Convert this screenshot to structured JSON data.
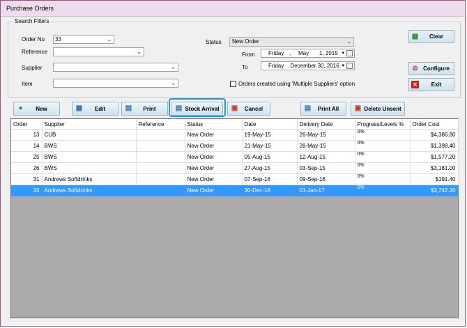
{
  "window": {
    "title": "Purchase Orders"
  },
  "filters": {
    "group_title": "Search Filters",
    "order_no_label": "Order No",
    "order_no_value": "33",
    "reference_label": "Reference",
    "reference_value": "",
    "supplier_label": "Supplier",
    "supplier_value": "",
    "item_label": "Item",
    "item_value": "",
    "status_label": "Status",
    "status_value": "New Order",
    "from_label": "From",
    "from_day": "Friday",
    "from_sep": ",",
    "from_month": "May",
    "from_date": "1, 2015",
    "to_label": "To",
    "to_day": "Friday",
    "to_rest": ", December 30, 2016",
    "multi_supplier_label": "Orders created using 'Multiple Suppliers' option",
    "multi_supplier_checked": false
  },
  "side_buttons": {
    "clear": "Clear",
    "configure": "Configure",
    "exit": "Exit"
  },
  "toolbar": {
    "new": "New",
    "edit": "Edit",
    "print": "Print",
    "stock_arrival": "Stock Arrival",
    "cancel": "Cancel",
    "print_all": "Print All",
    "delete_unsent": "Delete Unsent"
  },
  "table": {
    "columns": [
      "Order",
      "Supplier",
      "Reference",
      "Status",
      "Date",
      "Delivery Date",
      "Progress/Levels %",
      "Order Cost"
    ],
    "rows": [
      {
        "order": "13",
        "supplier": "CUB",
        "reference": "",
        "status": "New Order",
        "date": "19-May-15",
        "delivery": "26-May-15",
        "progress": "0%",
        "cost": "$4,386.80"
      },
      {
        "order": "14",
        "supplier": "BWS",
        "reference": "",
        "status": "New Order",
        "date": "21-May-15",
        "delivery": "28-May-15",
        "progress": "0%",
        "cost": "$1,398.40"
      },
      {
        "order": "25",
        "supplier": "BWS",
        "reference": "",
        "status": "New Order",
        "date": "05-Aug-15",
        "delivery": "12-Aug-15",
        "progress": "0%",
        "cost": "$1,577.20"
      },
      {
        "order": "26",
        "supplier": "BWS",
        "reference": "",
        "status": "New Order",
        "date": "27-Aug-15",
        "delivery": "03-Sep-15",
        "progress": "0%",
        "cost": "$3,181.00"
      },
      {
        "order": "31",
        "supplier": "Andrews Softdrinks",
        "reference": "",
        "status": "New Order",
        "date": "07-Sep-16",
        "delivery": "09-Sep-16",
        "progress": "0%",
        "cost": "$191.40"
      },
      {
        "order": "33",
        "supplier": "Andrews Softdrinks",
        "reference": "",
        "status": "New Order",
        "date": "30-Dec-16",
        "delivery": "01-Jan-17",
        "progress": "0%",
        "cost": "$3,742.20",
        "selected": true
      }
    ]
  },
  "colors": {
    "selection": "#3399ff",
    "grid_background": "#ababab",
    "highlight": "#1a9ad6"
  }
}
